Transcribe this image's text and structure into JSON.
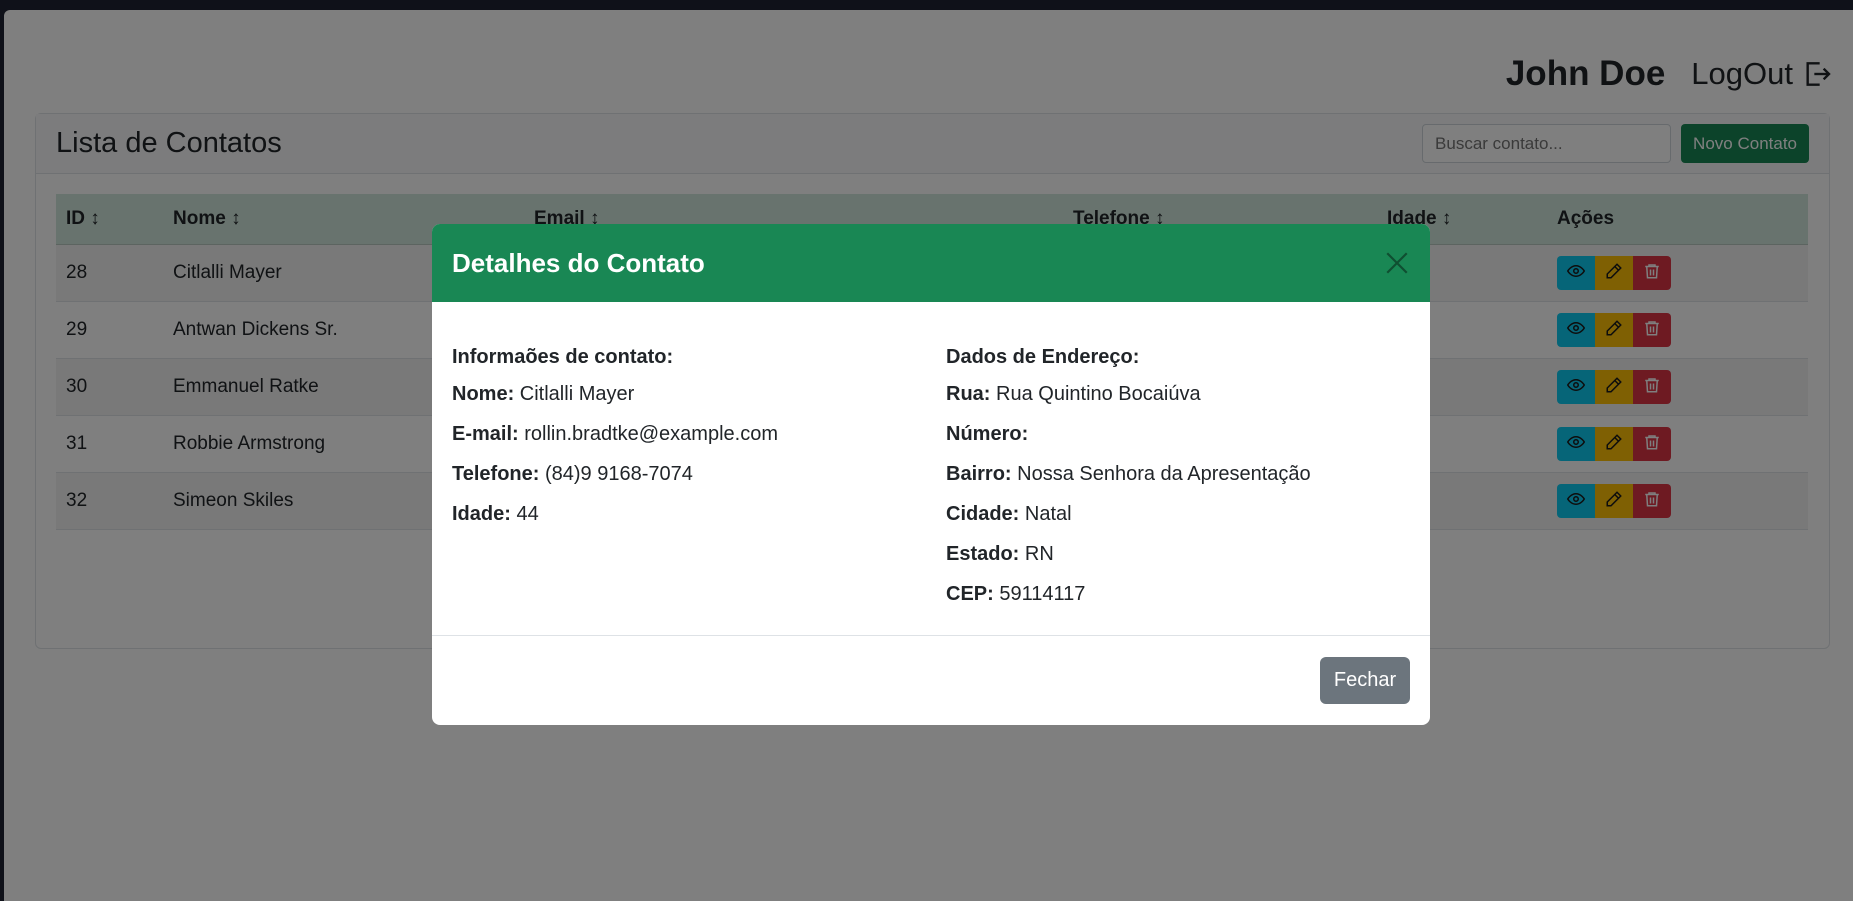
{
  "header": {
    "username": "John Doe",
    "logout_label": "LogOut"
  },
  "card": {
    "title": "Lista de Contatos",
    "search_placeholder": "Buscar contato...",
    "new_button": "Novo Contato"
  },
  "table": {
    "columns": [
      "ID ↕",
      "Nome ↕",
      "Email ↕",
      "Telefone ↕",
      "Idade ↕",
      "Ações"
    ],
    "rows": [
      {
        "id": "28",
        "nome": "Citlalli Mayer"
      },
      {
        "id": "29",
        "nome": "Antwan Dickens Sr."
      },
      {
        "id": "30",
        "nome": "Emmanuel Ratke"
      },
      {
        "id": "31",
        "nome": "Robbie Armstrong"
      },
      {
        "id": "32",
        "nome": "Simeon Skiles"
      }
    ]
  },
  "modal": {
    "title": "Detalhes do Contato",
    "left": {
      "heading": "Informaões de contato:",
      "nome_label": "Nome:",
      "nome": "Citlalli Mayer",
      "email_label": "E-mail:",
      "email": "rollin.bradtke@example.com",
      "telefone_label": "Telefone:",
      "telefone": "(84)9 9168-7074",
      "idade_label": "Idade:",
      "idade": "44"
    },
    "right": {
      "heading": "Dados de Endereço:",
      "rua_label": "Rua:",
      "rua": "Rua Quintino Bocaiúva",
      "numero_label": "Número:",
      "numero": "",
      "bairro_label": "Bairro:",
      "bairro": "Nossa Senhora da Apresentação",
      "cidade_label": "Cidade:",
      "cidade": "Natal",
      "estado_label": "Estado:",
      "estado": "RN",
      "cep_label": "CEP:",
      "cep": "59114117"
    },
    "close_button": "Fechar"
  },
  "colors": {
    "primary_green": "#198754",
    "table_header": "#d1e7dd",
    "view": "#0dcaf0",
    "edit": "#ffc107",
    "delete": "#dc3545",
    "secondary": "#6c757d"
  },
  "icons": {
    "logout": "logout-icon",
    "view": "eye-icon",
    "edit": "pencil-icon",
    "delete": "trash-icon",
    "close": "close-icon"
  }
}
